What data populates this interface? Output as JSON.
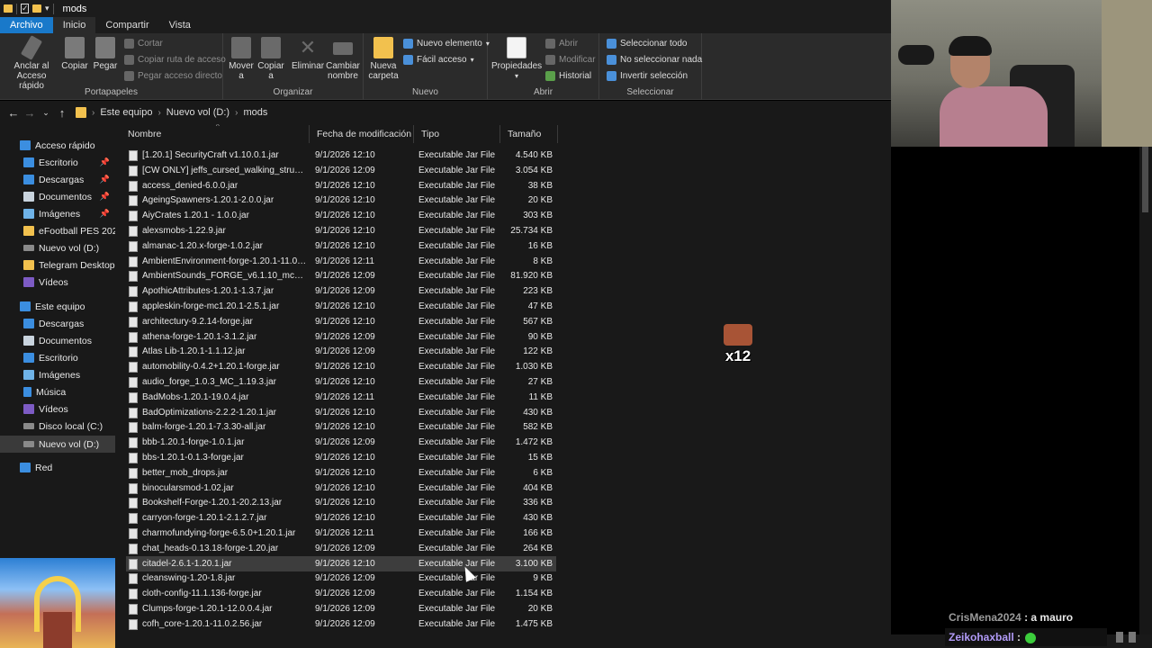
{
  "window": {
    "title": "mods"
  },
  "menu": {
    "file": "Archivo",
    "home": "Inicio",
    "share": "Compartir",
    "view": "Vista"
  },
  "ribbon": {
    "clipboard": {
      "pin": "Anclar al\nAcceso rápido",
      "copy": "Copiar",
      "paste": "Pegar",
      "cut": "Cortar",
      "copy_path": "Copiar ruta de acceso",
      "paste_shortcut": "Pegar acceso directo",
      "label": "Portapapeles"
    },
    "organize": {
      "move": "Mover\na",
      "copy_to": "Copiar\na",
      "delete": "Eliminar",
      "rename": "Cambiar\nnombre",
      "label": "Organizar"
    },
    "new": {
      "new_folder": "Nueva\ncarpeta",
      "new_item": "Nuevo elemento",
      "easy_access": "Fácil acceso",
      "label": "Nuevo"
    },
    "open": {
      "properties": "Propiedades",
      "open": "Abrir",
      "edit": "Modificar",
      "history": "Historial",
      "label": "Abrir"
    },
    "select": {
      "select_all": "Seleccionar todo",
      "select_none": "No seleccionar nada",
      "invert": "Invertir selección",
      "label": "Seleccionar"
    }
  },
  "address": {
    "segments": [
      "Este equipo",
      "Nuevo vol (D:)",
      "mods"
    ]
  },
  "sidebar": {
    "items": [
      {
        "label": "Acceso rápido",
        "pinned": false
      },
      {
        "label": "Escritorio",
        "pinned": true
      },
      {
        "label": "Descargas",
        "pinned": true
      },
      {
        "label": "Documentos",
        "pinned": true
      },
      {
        "label": "Imágenes",
        "pinned": true
      },
      {
        "label": "eFootball PES 2021",
        "pinned": false
      },
      {
        "label": "Nuevo vol (D:)",
        "pinned": false
      },
      {
        "label": "Telegram Desktop",
        "pinned": false
      },
      {
        "label": "Vídeos",
        "pinned": false
      },
      {
        "label": "Este equipo",
        "pinned": false
      },
      {
        "label": "Descargas",
        "pinned": false
      },
      {
        "label": "Documentos",
        "pinned": false
      },
      {
        "label": "Escritorio",
        "pinned": false
      },
      {
        "label": "Imágenes",
        "pinned": false
      },
      {
        "label": "Música",
        "pinned": false
      },
      {
        "label": "Vídeos",
        "pinned": false
      },
      {
        "label": "Disco local (C:)",
        "pinned": false
      },
      {
        "label": "Nuevo vol (D:)",
        "pinned": false
      },
      {
        "label": "Red",
        "pinned": false
      }
    ]
  },
  "columns": {
    "name": "Nombre",
    "date": "Fecha de modificación",
    "type": "Tipo",
    "size": "Tamaño"
  },
  "files": [
    {
      "name": "[1.20.1] SecurityCraft v1.10.0.1.jar",
      "date": "9/1/2026 12:10",
      "type": "Executable Jar File",
      "size": "4.540 KB"
    },
    {
      "name": "[CW ONLY] jeffs_cursed_walking_structur...",
      "date": "9/1/2026 12:09",
      "type": "Executable Jar File",
      "size": "3.054 KB"
    },
    {
      "name": "access_denied-6.0.0.jar",
      "date": "9/1/2026 12:10",
      "type": "Executable Jar File",
      "size": "38 KB"
    },
    {
      "name": "AgeingSpawners-1.20.1-2.0.0.jar",
      "date": "9/1/2026 12:10",
      "type": "Executable Jar File",
      "size": "20 KB"
    },
    {
      "name": "AiyCrates 1.20.1 - 1.0.0.jar",
      "date": "9/1/2026 12:10",
      "type": "Executable Jar File",
      "size": "303 KB"
    },
    {
      "name": "alexsmobs-1.22.9.jar",
      "date": "9/1/2026 12:10",
      "type": "Executable Jar File",
      "size": "25.734 KB"
    },
    {
      "name": "almanac-1.20.x-forge-1.0.2.jar",
      "date": "9/1/2026 12:10",
      "type": "Executable Jar File",
      "size": "16 KB"
    },
    {
      "name": "AmbientEnvironment-forge-1.20.1-11.0.0...",
      "date": "9/1/2026 12:11",
      "type": "Executable Jar File",
      "size": "8 KB"
    },
    {
      "name": "AmbientSounds_FORGE_v6.1.10_mc1.20...",
      "date": "9/1/2026 12:09",
      "type": "Executable Jar File",
      "size": "81.920 KB"
    },
    {
      "name": "ApothicAttributes-1.20.1-1.3.7.jar",
      "date": "9/1/2026 12:09",
      "type": "Executable Jar File",
      "size": "223 KB"
    },
    {
      "name": "appleskin-forge-mc1.20.1-2.5.1.jar",
      "date": "9/1/2026 12:10",
      "type": "Executable Jar File",
      "size": "47 KB"
    },
    {
      "name": "architectury-9.2.14-forge.jar",
      "date": "9/1/2026 12:10",
      "type": "Executable Jar File",
      "size": "567 KB"
    },
    {
      "name": "athena-forge-1.20.1-3.1.2.jar",
      "date": "9/1/2026 12:09",
      "type": "Executable Jar File",
      "size": "90 KB"
    },
    {
      "name": "Atlas Lib-1.20.1-1.1.12.jar",
      "date": "9/1/2026 12:09",
      "type": "Executable Jar File",
      "size": "122 KB"
    },
    {
      "name": "automobility-0.4.2+1.20.1-forge.jar",
      "date": "9/1/2026 12:10",
      "type": "Executable Jar File",
      "size": "1.030 KB"
    },
    {
      "name": "audio_forge_1.0.3_MC_1.19.3.jar",
      "date": "9/1/2026 12:10",
      "type": "Executable Jar File",
      "size": "27 KB"
    },
    {
      "name": "BadMobs-1.20.1-19.0.4.jar",
      "date": "9/1/2026 12:11",
      "type": "Executable Jar File",
      "size": "11 KB"
    },
    {
      "name": "BadOptimizations-2.2.2-1.20.1.jar",
      "date": "9/1/2026 12:10",
      "type": "Executable Jar File",
      "size": "430 KB"
    },
    {
      "name": "balm-forge-1.20.1-7.3.30-all.jar",
      "date": "9/1/2026 12:10",
      "type": "Executable Jar File",
      "size": "582 KB"
    },
    {
      "name": "bbb-1.20.1-forge-1.0.1.jar",
      "date": "9/1/2026 12:09",
      "type": "Executable Jar File",
      "size": "1.472 KB"
    },
    {
      "name": "bbs-1.20.1-0.1.3-forge.jar",
      "date": "9/1/2026 12:10",
      "type": "Executable Jar File",
      "size": "15 KB"
    },
    {
      "name": "better_mob_drops.jar",
      "date": "9/1/2026 12:10",
      "type": "Executable Jar File",
      "size": "6 KB"
    },
    {
      "name": "binocularsmod-1.02.jar",
      "date": "9/1/2026 12:10",
      "type": "Executable Jar File",
      "size": "404 KB"
    },
    {
      "name": "Bookshelf-Forge-1.20.1-20.2.13.jar",
      "date": "9/1/2026 12:10",
      "type": "Executable Jar File",
      "size": "336 KB"
    },
    {
      "name": "carryon-forge-1.20.1-2.1.2.7.jar",
      "date": "9/1/2026 12:10",
      "type": "Executable Jar File",
      "size": "430 KB"
    },
    {
      "name": "charmofundying-forge-6.5.0+1.20.1.jar",
      "date": "9/1/2026 12:11",
      "type": "Executable Jar File",
      "size": "166 KB"
    },
    {
      "name": "chat_heads-0.13.18-forge-1.20.jar",
      "date": "9/1/2026 12:09",
      "type": "Executable Jar File",
      "size": "264 KB"
    },
    {
      "name": "citadel-2.6.1-1.20.1.jar",
      "date": "9/1/2026 12:10",
      "type": "Executable Jar File",
      "size": "3.100 KB"
    },
    {
      "name": "cleanswing-1.20-1.8.jar",
      "date": "9/1/2026 12:09",
      "type": "Executable Jar File",
      "size": "9 KB"
    },
    {
      "name": "cloth-config-11.1.136-forge.jar",
      "date": "9/1/2026 12:09",
      "type": "Executable Jar File",
      "size": "1.154 KB"
    },
    {
      "name": "Clumps-forge-1.20.1-12.0.0.4.jar",
      "date": "9/1/2026 12:09",
      "type": "Executable Jar File",
      "size": "20 KB"
    },
    {
      "name": "cofh_core-1.20.1-11.0.2.56.jar",
      "date": "9/1/2026 12:09",
      "type": "Executable Jar File",
      "size": "1.475 KB"
    }
  ],
  "emote": {
    "count": "x12"
  },
  "chat": {
    "user1": "CrisMena2024",
    "msg1": ": a mauro",
    "user2": "Zeikohaxball",
    "msg2": ":"
  }
}
